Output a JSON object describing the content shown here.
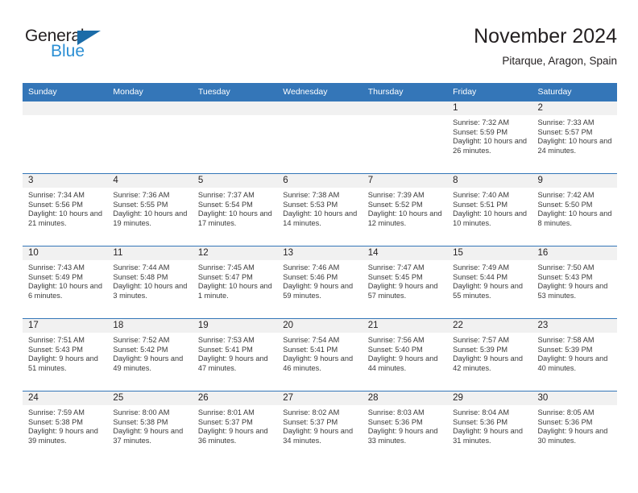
{
  "brand": {
    "word1": "General",
    "word2": "Blue",
    "triangle_color": "#1b6ca8",
    "blue_color": "#2b8fd4"
  },
  "header": {
    "title": "November 2024",
    "subtitle": "Pitarque, Aragon, Spain",
    "header_bg": "#3476b8",
    "daynum_bg": "#f1f1f1"
  },
  "weekdays": [
    "Sunday",
    "Monday",
    "Tuesday",
    "Wednesday",
    "Thursday",
    "Friday",
    "Saturday"
  ],
  "weeks": [
    [
      {
        "empty": true
      },
      {
        "empty": true
      },
      {
        "empty": true
      },
      {
        "empty": true
      },
      {
        "empty": true
      },
      {
        "day": "1",
        "sunrise": "Sunrise: 7:32 AM",
        "sunset": "Sunset: 5:59 PM",
        "daylight": "Daylight: 10 hours and 26 minutes."
      },
      {
        "day": "2",
        "sunrise": "Sunrise: 7:33 AM",
        "sunset": "Sunset: 5:57 PM",
        "daylight": "Daylight: 10 hours and 24 minutes."
      }
    ],
    [
      {
        "day": "3",
        "sunrise": "Sunrise: 7:34 AM",
        "sunset": "Sunset: 5:56 PM",
        "daylight": "Daylight: 10 hours and 21 minutes."
      },
      {
        "day": "4",
        "sunrise": "Sunrise: 7:36 AM",
        "sunset": "Sunset: 5:55 PM",
        "daylight": "Daylight: 10 hours and 19 minutes."
      },
      {
        "day": "5",
        "sunrise": "Sunrise: 7:37 AM",
        "sunset": "Sunset: 5:54 PM",
        "daylight": "Daylight: 10 hours and 17 minutes."
      },
      {
        "day": "6",
        "sunrise": "Sunrise: 7:38 AM",
        "sunset": "Sunset: 5:53 PM",
        "daylight": "Daylight: 10 hours and 14 minutes."
      },
      {
        "day": "7",
        "sunrise": "Sunrise: 7:39 AM",
        "sunset": "Sunset: 5:52 PM",
        "daylight": "Daylight: 10 hours and 12 minutes."
      },
      {
        "day": "8",
        "sunrise": "Sunrise: 7:40 AM",
        "sunset": "Sunset: 5:51 PM",
        "daylight": "Daylight: 10 hours and 10 minutes."
      },
      {
        "day": "9",
        "sunrise": "Sunrise: 7:42 AM",
        "sunset": "Sunset: 5:50 PM",
        "daylight": "Daylight: 10 hours and 8 minutes."
      }
    ],
    [
      {
        "day": "10",
        "sunrise": "Sunrise: 7:43 AM",
        "sunset": "Sunset: 5:49 PM",
        "daylight": "Daylight: 10 hours and 6 minutes."
      },
      {
        "day": "11",
        "sunrise": "Sunrise: 7:44 AM",
        "sunset": "Sunset: 5:48 PM",
        "daylight": "Daylight: 10 hours and 3 minutes."
      },
      {
        "day": "12",
        "sunrise": "Sunrise: 7:45 AM",
        "sunset": "Sunset: 5:47 PM",
        "daylight": "Daylight: 10 hours and 1 minute."
      },
      {
        "day": "13",
        "sunrise": "Sunrise: 7:46 AM",
        "sunset": "Sunset: 5:46 PM",
        "daylight": "Daylight: 9 hours and 59 minutes."
      },
      {
        "day": "14",
        "sunrise": "Sunrise: 7:47 AM",
        "sunset": "Sunset: 5:45 PM",
        "daylight": "Daylight: 9 hours and 57 minutes."
      },
      {
        "day": "15",
        "sunrise": "Sunrise: 7:49 AM",
        "sunset": "Sunset: 5:44 PM",
        "daylight": "Daylight: 9 hours and 55 minutes."
      },
      {
        "day": "16",
        "sunrise": "Sunrise: 7:50 AM",
        "sunset": "Sunset: 5:43 PM",
        "daylight": "Daylight: 9 hours and 53 minutes."
      }
    ],
    [
      {
        "day": "17",
        "sunrise": "Sunrise: 7:51 AM",
        "sunset": "Sunset: 5:43 PM",
        "daylight": "Daylight: 9 hours and 51 minutes."
      },
      {
        "day": "18",
        "sunrise": "Sunrise: 7:52 AM",
        "sunset": "Sunset: 5:42 PM",
        "daylight": "Daylight: 9 hours and 49 minutes."
      },
      {
        "day": "19",
        "sunrise": "Sunrise: 7:53 AM",
        "sunset": "Sunset: 5:41 PM",
        "daylight": "Daylight: 9 hours and 47 minutes."
      },
      {
        "day": "20",
        "sunrise": "Sunrise: 7:54 AM",
        "sunset": "Sunset: 5:41 PM",
        "daylight": "Daylight: 9 hours and 46 minutes."
      },
      {
        "day": "21",
        "sunrise": "Sunrise: 7:56 AM",
        "sunset": "Sunset: 5:40 PM",
        "daylight": "Daylight: 9 hours and 44 minutes."
      },
      {
        "day": "22",
        "sunrise": "Sunrise: 7:57 AM",
        "sunset": "Sunset: 5:39 PM",
        "daylight": "Daylight: 9 hours and 42 minutes."
      },
      {
        "day": "23",
        "sunrise": "Sunrise: 7:58 AM",
        "sunset": "Sunset: 5:39 PM",
        "daylight": "Daylight: 9 hours and 40 minutes."
      }
    ],
    [
      {
        "day": "24",
        "sunrise": "Sunrise: 7:59 AM",
        "sunset": "Sunset: 5:38 PM",
        "daylight": "Daylight: 9 hours and 39 minutes."
      },
      {
        "day": "25",
        "sunrise": "Sunrise: 8:00 AM",
        "sunset": "Sunset: 5:38 PM",
        "daylight": "Daylight: 9 hours and 37 minutes."
      },
      {
        "day": "26",
        "sunrise": "Sunrise: 8:01 AM",
        "sunset": "Sunset: 5:37 PM",
        "daylight": "Daylight: 9 hours and 36 minutes."
      },
      {
        "day": "27",
        "sunrise": "Sunrise: 8:02 AM",
        "sunset": "Sunset: 5:37 PM",
        "daylight": "Daylight: 9 hours and 34 minutes."
      },
      {
        "day": "28",
        "sunrise": "Sunrise: 8:03 AM",
        "sunset": "Sunset: 5:36 PM",
        "daylight": "Daylight: 9 hours and 33 minutes."
      },
      {
        "day": "29",
        "sunrise": "Sunrise: 8:04 AM",
        "sunset": "Sunset: 5:36 PM",
        "daylight": "Daylight: 9 hours and 31 minutes."
      },
      {
        "day": "30",
        "sunrise": "Sunrise: 8:05 AM",
        "sunset": "Sunset: 5:36 PM",
        "daylight": "Daylight: 9 hours and 30 minutes."
      }
    ]
  ]
}
